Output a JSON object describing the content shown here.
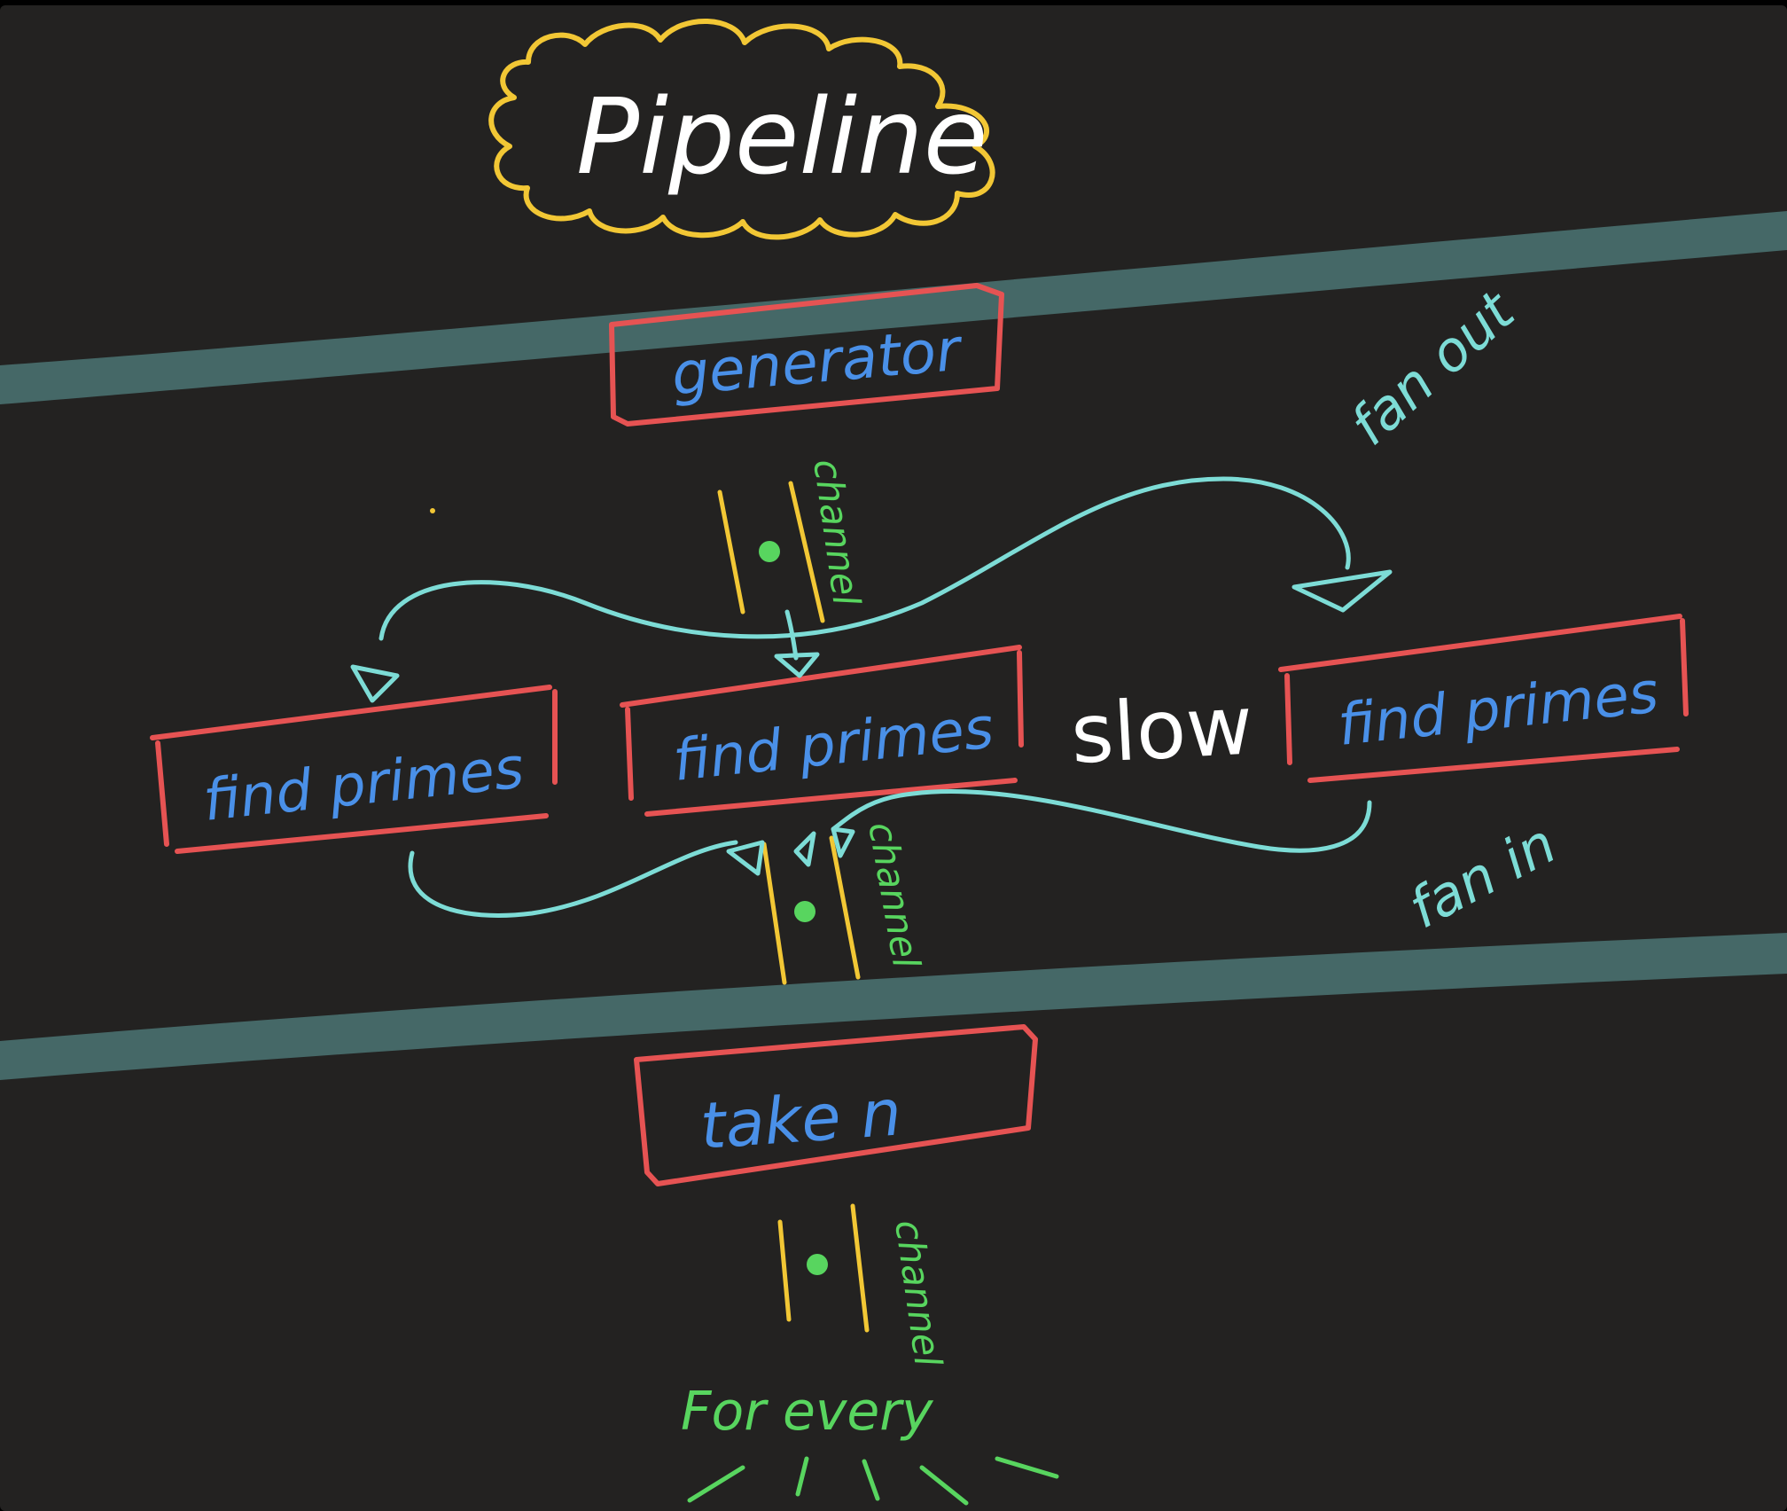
{
  "title": "Pipeline",
  "stages": {
    "generator": "generator",
    "find_primes_left": "find primes",
    "find_primes_center": "find primes",
    "find_primes_right": "find primes",
    "take_n": "take n"
  },
  "channels": {
    "top": "channel",
    "middle": "channel",
    "bottom": "channel"
  },
  "annotations": {
    "fan_out": "fan out",
    "fan_in": "fan in",
    "slow": "slow",
    "for_every": "For every"
  },
  "colors": {
    "background": "#232221",
    "title_cloud": "#f2c735",
    "title_text": "#ffffff",
    "box_border": "#e65353",
    "stage_text": "#4a90e8",
    "channel_line": "#f2c735",
    "channel_dot": "#58d55f",
    "channel_label": "#58d55f",
    "arrows": "#7ddcd6",
    "band": "#456867",
    "slow_text": "#ffffff",
    "for_every_text": "#58d55f"
  }
}
